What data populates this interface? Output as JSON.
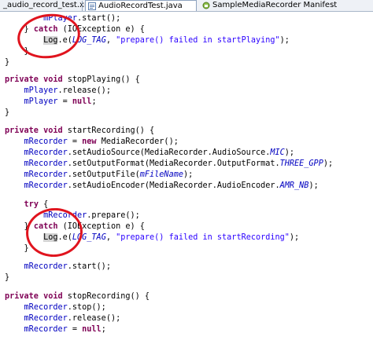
{
  "tabs": [
    {
      "label": "_audio_record_test.xml"
    },
    {
      "label": "AudioRecordTest.java"
    },
    {
      "label": "SampleMediaRecorder Manifest"
    }
  ],
  "code": {
    "l01": [
      "mPlayer",
      ".start();"
    ],
    "l02": [
      "} ",
      "catch",
      " (IOException e) {"
    ],
    "l03": [
      "Log",
      ".e(",
      "LOG_TAG",
      ", ",
      "\"prepare() failed in startPlaying\"",
      ");"
    ],
    "l04": [
      "}"
    ],
    "l05": [
      "}"
    ],
    "l06": [
      "private",
      " ",
      "void",
      " stopPlaying() {"
    ],
    "l07": [
      "mPlayer",
      ".release();"
    ],
    "l08": [
      "mPlayer",
      " = ",
      "null",
      ";"
    ],
    "l09": [
      "}"
    ],
    "l10": [
      "private",
      " ",
      "void",
      " startRecording() {"
    ],
    "l11": [
      "mRecorder",
      " = ",
      "new",
      " MediaRecorder();"
    ],
    "l12": [
      "mRecorder",
      ".setAudioSource(MediaRecorder.AudioSource.",
      "MIC",
      ");"
    ],
    "l13": [
      "mRecorder",
      ".setOutputFormat(MediaRecorder.OutputFormat.",
      "THREE_GPP",
      ");"
    ],
    "l14": [
      "mRecorder",
      ".setOutputFile(",
      "mFileName",
      ");"
    ],
    "l15": [
      "mRecorder",
      ".setAudioEncoder(MediaRecorder.AudioEncoder.",
      "AMR_NB",
      ");"
    ],
    "l16": [
      "try",
      " {"
    ],
    "l17": [
      "mRecorder",
      ".prepare();"
    ],
    "l18": [
      "} ",
      "catch",
      " (IOException e) {"
    ],
    "l19": [
      "Log",
      ".e(",
      "LOG_TAG",
      ", ",
      "\"prepare() failed in startRecording\"",
      ");"
    ],
    "l20": [
      "}"
    ],
    "l21": [
      "mRecorder",
      ".start();"
    ],
    "l22": [
      "}"
    ],
    "l23": [
      "private",
      " ",
      "void",
      " stopRecording() {"
    ],
    "l24": [
      "mRecorder",
      ".stop();"
    ],
    "l25": [
      "mRecorder",
      ".release();"
    ],
    "l26": [
      "mRecorder",
      " = ",
      "null",
      ";"
    ]
  },
  "colors": {
    "annotation": "#e0141e",
    "keyword": "#7f0055",
    "field": "#0000c0",
    "string": "#2a00ff"
  },
  "icons": [
    "xml-file-icon",
    "java-file-icon",
    "manifest-file-icon"
  ]
}
